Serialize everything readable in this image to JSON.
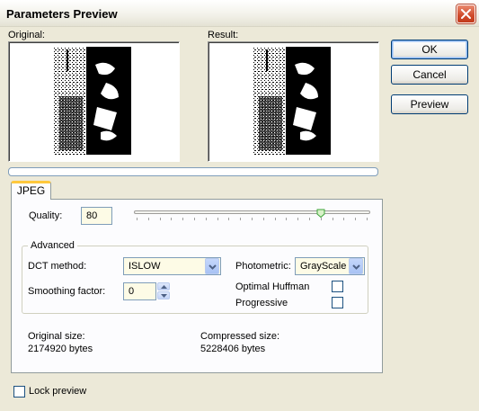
{
  "window": {
    "title": "Parameters Preview"
  },
  "preview": {
    "original_label": "Original:",
    "result_label": "Result:"
  },
  "buttons": {
    "ok": "OK",
    "cancel": "Cancel",
    "preview": "Preview"
  },
  "tabs": [
    {
      "label": "JPEG",
      "selected": true
    }
  ],
  "quality": {
    "label": "Quality:",
    "value": "80",
    "slider_fraction": 0.8
  },
  "advanced": {
    "legend": "Advanced",
    "dct_method": {
      "label": "DCT method:",
      "value": "ISLOW"
    },
    "photometric": {
      "label": "Photometric:",
      "value": "GrayScale"
    },
    "smoothing": {
      "label": "Smoothing factor:",
      "value": "0"
    },
    "optimal_huffman": {
      "label": "Optimal Huffman",
      "checked": false
    },
    "progressive": {
      "label": "Progressive",
      "checked": false
    }
  },
  "sizes": {
    "original_label": "Original size:",
    "original_value": "2174920 bytes",
    "compressed_label": "Compressed size:",
    "compressed_value": "5228406 bytes"
  },
  "lock_preview": {
    "label": "Lock preview",
    "checked": false
  },
  "colors": {
    "dialog_bg": "#ece9d8",
    "panel_bg": "#fcfcfe",
    "accent_border": "#003c74",
    "tab_highlight": "#ffc83c",
    "close_button": "#cf4a2a"
  }
}
